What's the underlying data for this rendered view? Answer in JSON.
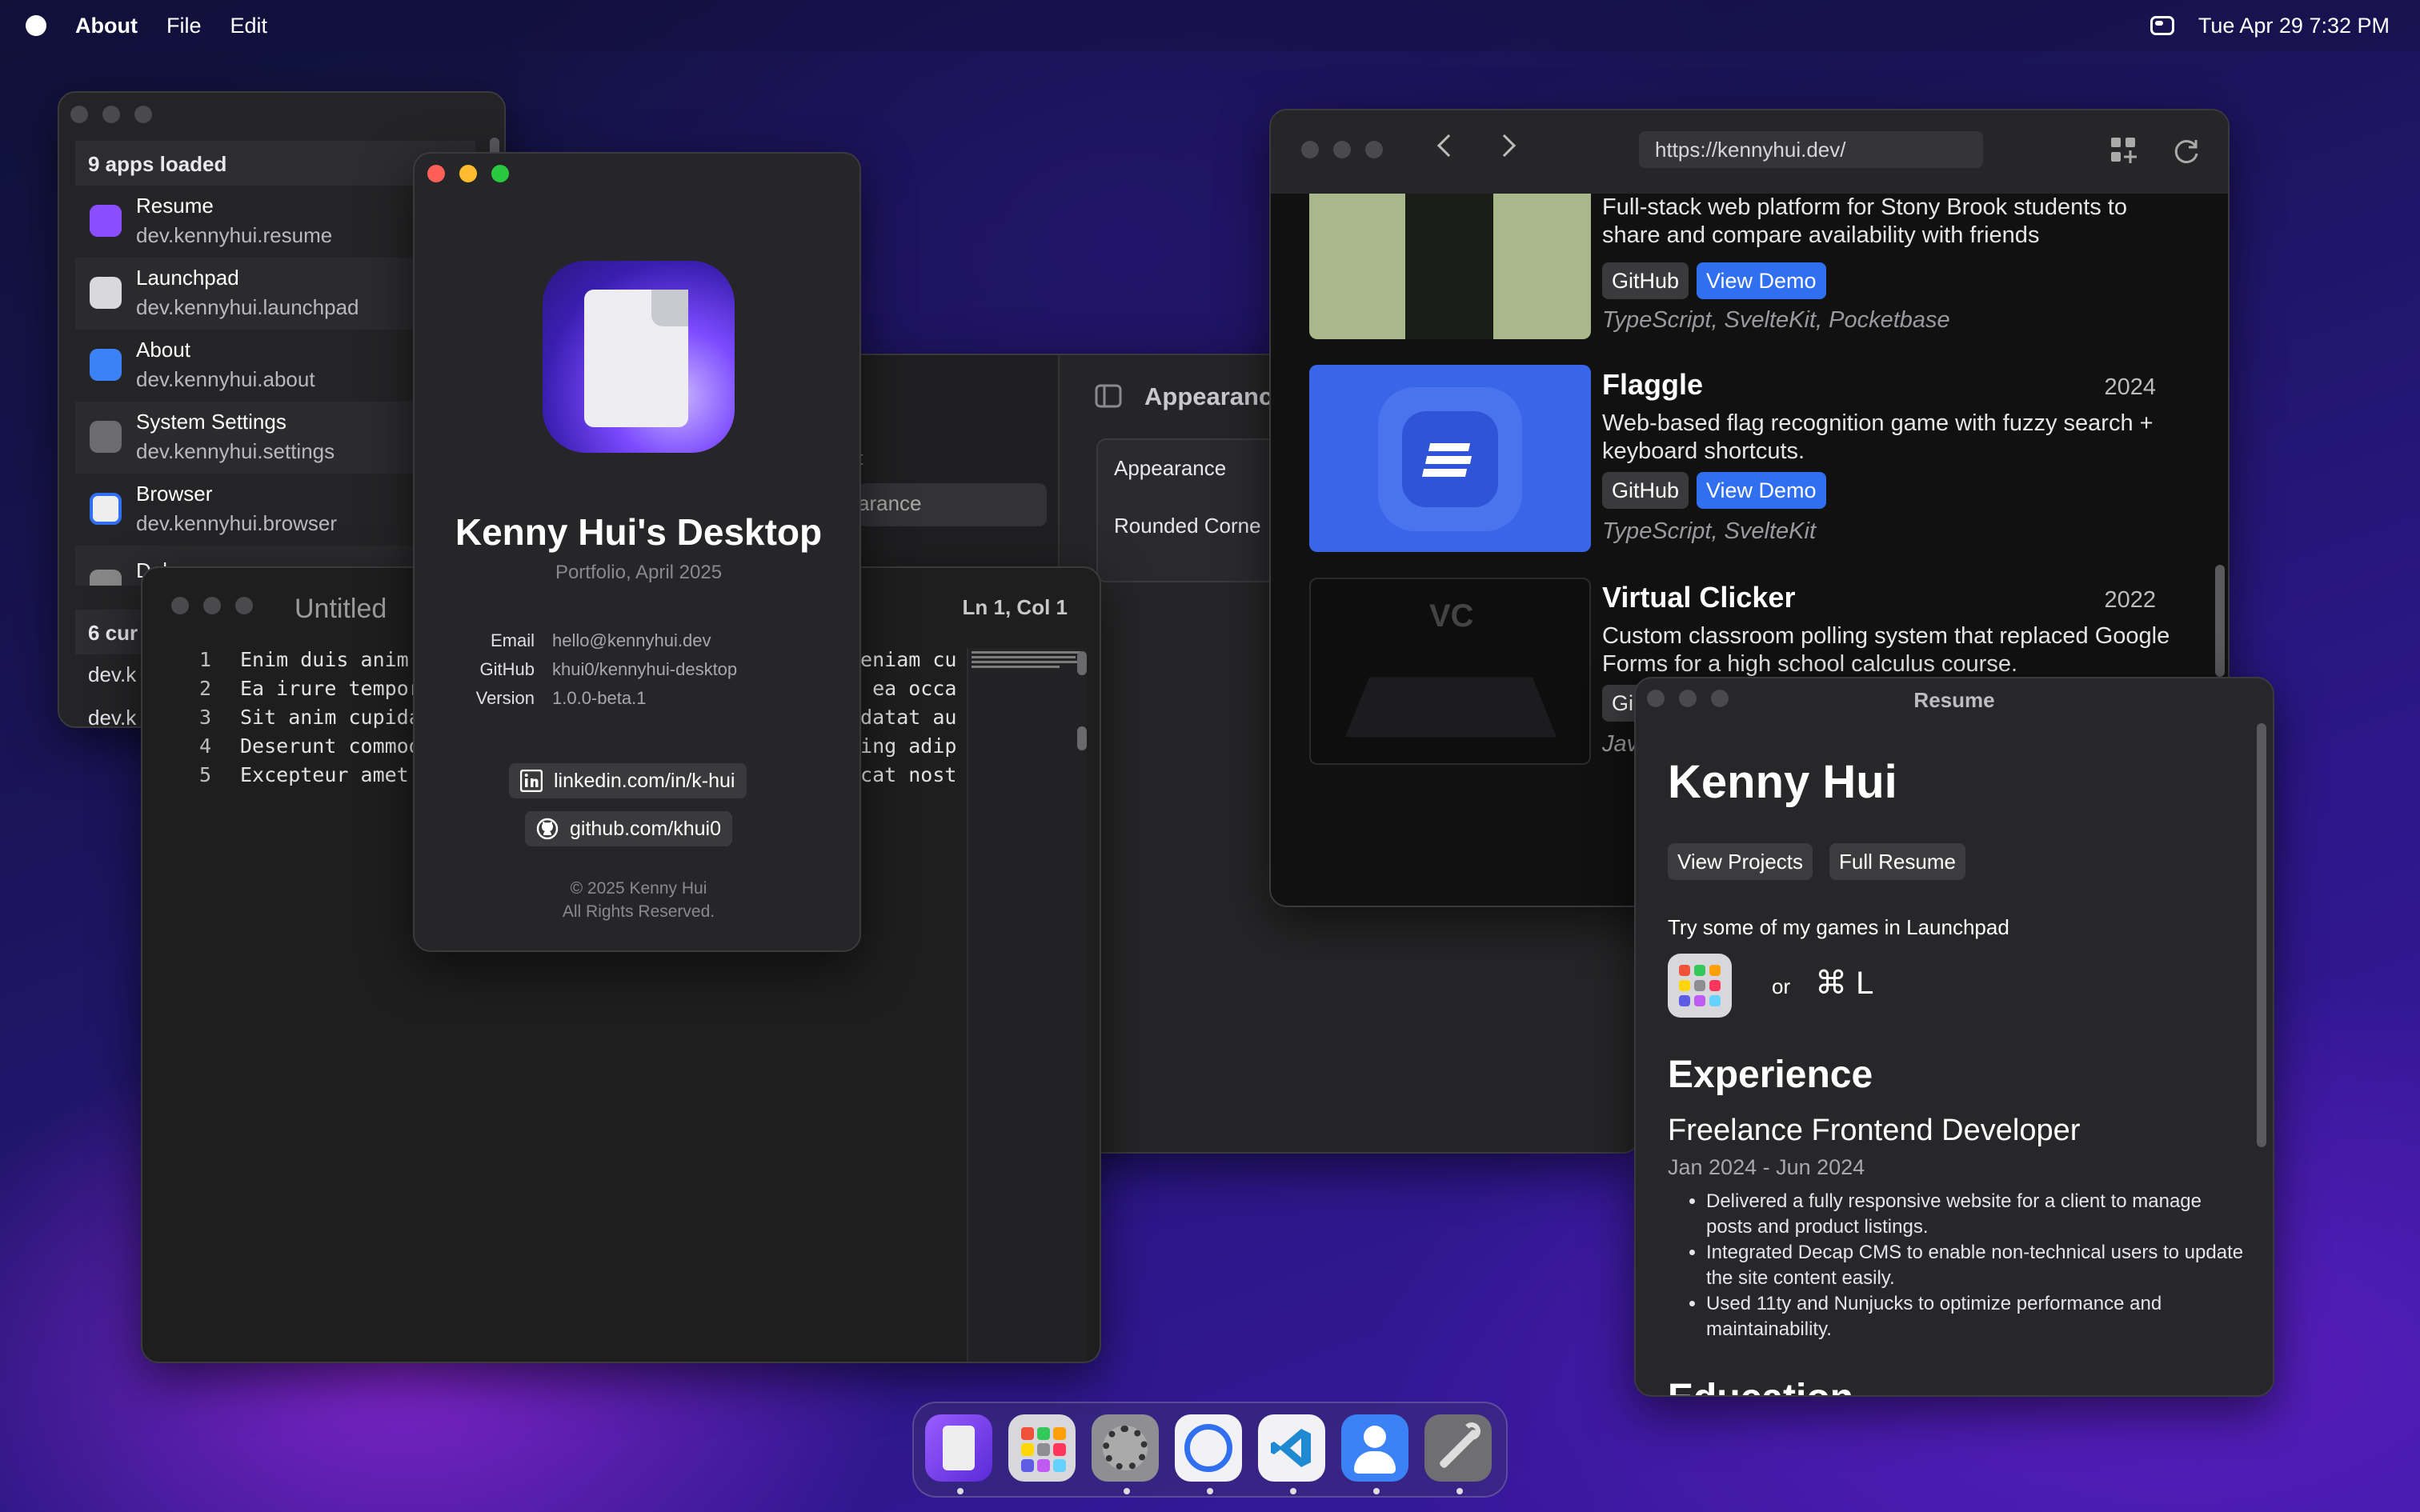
{
  "menubar": {
    "app_name": "About",
    "menus": [
      "File",
      "Edit"
    ],
    "datetime": "Tue Apr 29 7:32 PM"
  },
  "app_list": {
    "header": "9 apps loaded",
    "apps": [
      {
        "name": "Resume",
        "id": "dev.kennyhui.resume",
        "icon": "resume-icon"
      },
      {
        "name": "Launchpad",
        "id": "dev.kennyhui.launchpad",
        "icon": "launchpad-icon"
      },
      {
        "name": "About",
        "id": "dev.kennyhui.about",
        "icon": "about-icon"
      },
      {
        "name": "System Settings",
        "id": "dev.kennyhui.settings",
        "icon": "settings-icon"
      },
      {
        "name": "Browser",
        "id": "dev.kennyhui.browser",
        "icon": "browser-icon"
      },
      {
        "name": "Debug",
        "id": "",
        "icon": "debug-icon"
      }
    ],
    "second_header": "6 cur",
    "second_items": [
      "dev.k",
      "dev.k"
    ]
  },
  "editor": {
    "title": "Untitled",
    "cursor": "Ln 1, Col 1",
    "lines": [
      {
        "n": "1",
        "a": "Enim duis anim",
        "b": "veniam cu"
      },
      {
        "n": "2",
        "a": "Ea irure tempor",
        "b": "d ea occa"
      },
      {
        "n": "3",
        "a": "Sit anim cupida",
        "b": "idatat au"
      },
      {
        "n": "4",
        "a": "Deserunt commod",
        "b": "cing adip"
      },
      {
        "n": "5",
        "a": "Excepteur amet",
        "b": "ecat nost"
      }
    ]
  },
  "settings": {
    "title": "Appearance",
    "rows": [
      "Appearance",
      "Rounded Corne"
    ],
    "side_fragment_1": "t",
    "side_fragment_2": "arance"
  },
  "about": {
    "app_title": "Kenny Hui's Desktop",
    "subtitle": "Portfolio, April 2025",
    "email_label": "Email",
    "email": "hello@kennyhui.dev",
    "github_label": "GitHub",
    "github": "khui0/kennyhui-desktop",
    "version_label": "Version",
    "version": "1.0.0-beta.1",
    "linkedin_link": "linkedin.com/in/k-hui",
    "github_link": "github.com/khui0",
    "copyright": "© 2025 Kenny Hui",
    "rights": "All Rights Reserved."
  },
  "browser": {
    "url": "https://kennyhui.dev/",
    "projects": [
      {
        "title": "",
        "year": "",
        "desc": "Full-stack web platform for Stony Brook students to share and compare availability with friends",
        "github": "GitHub",
        "demo": "View Demo",
        "tags": "TypeScript, SvelteKit, Pocketbase"
      },
      {
        "title": "Flaggle",
        "year": "2024",
        "desc": "Web-based flag recognition game with fuzzy search + keyboard shortcuts.",
        "github": "GitHub",
        "demo": "View Demo",
        "tags": "TypeScript, SvelteKit"
      },
      {
        "title": "Virtual Clicker",
        "year": "2022",
        "desc": "Custom classroom polling system that replaced Google Forms for a high school calculus course.",
        "github": "Gi",
        "demo": "",
        "tags": "Jav"
      }
    ]
  },
  "resume": {
    "window_title": "Resume",
    "name": "Kenny Hui",
    "btn_projects": "View Projects",
    "btn_full": "Full Resume",
    "try_text": "Try some of my games in Launchpad",
    "or": "or",
    "shortcut": "⌘ L",
    "experience_heading": "Experience",
    "job_title": "Freelance Frontend Developer",
    "job_dates": "Jan 2024 - Jun 2024",
    "bullets": [
      "Delivered a fully responsive website for a client to manage posts and product listings.",
      "Integrated Decap CMS to enable non-technical users to update the site content easily.",
      "Used 11ty and Nunjucks to optimize performance and maintainability."
    ],
    "education_heading": "Education"
  },
  "dock": {
    "items": [
      "resume-icon",
      "launchpad-icon",
      "settings-icon",
      "browser-icon",
      "vscode-icon",
      "about-icon",
      "debug-icon"
    ]
  },
  "colors": {
    "close": "#fe5f57",
    "minimize": "#febc2e",
    "zoom": "#28c840",
    "demo_button": "#2f6ff0",
    "resume_purple": "#8a4dff",
    "browser_blue": "#2f6ff0"
  }
}
